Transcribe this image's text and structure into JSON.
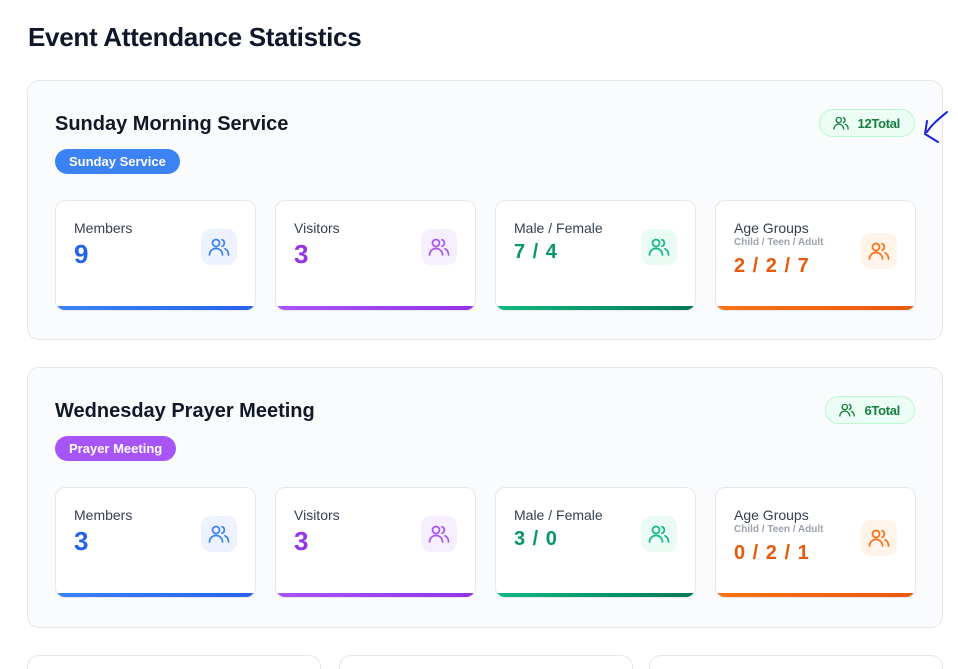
{
  "page": {
    "title": "Event Attendance Statistics"
  },
  "events": [
    {
      "title": "Sunday Morning Service",
      "tag": "Sunday Service",
      "tag_color": "#3b82f6",
      "total": "12",
      "total_label": "Total",
      "stats": {
        "members": {
          "label": "Members",
          "value": "9"
        },
        "visitors": {
          "label": "Visitors",
          "value": "3"
        },
        "gender": {
          "label": "Male / Female",
          "value": "7 / 4"
        },
        "age": {
          "label": "Age Groups",
          "sublabel": "Child / Teen / Adult",
          "value": "2 / 2 / 7"
        }
      }
    },
    {
      "title": "Wednesday Prayer Meeting",
      "tag": "Prayer Meeting",
      "tag_color": "#a855f7",
      "total": "6",
      "total_label": "Total",
      "stats": {
        "members": {
          "label": "Members",
          "value": "3"
        },
        "visitors": {
          "label": "Visitors",
          "value": "3"
        },
        "gender": {
          "label": "Male / Female",
          "value": "3 / 0"
        },
        "age": {
          "label": "Age Groups",
          "sublabel": "Child / Teen / Adult",
          "value": "0 / 2 / 1"
        }
      }
    }
  ],
  "icons": {
    "total": "users-icon",
    "members": "users-icon",
    "visitors": "users-icon",
    "gender": "users-icon",
    "age": "users-icon"
  },
  "colors": {
    "members": "#2563eb",
    "visitors": "#9333ea",
    "gender": "#059669",
    "age": "#ea580c",
    "total_badge": "#15803d"
  }
}
